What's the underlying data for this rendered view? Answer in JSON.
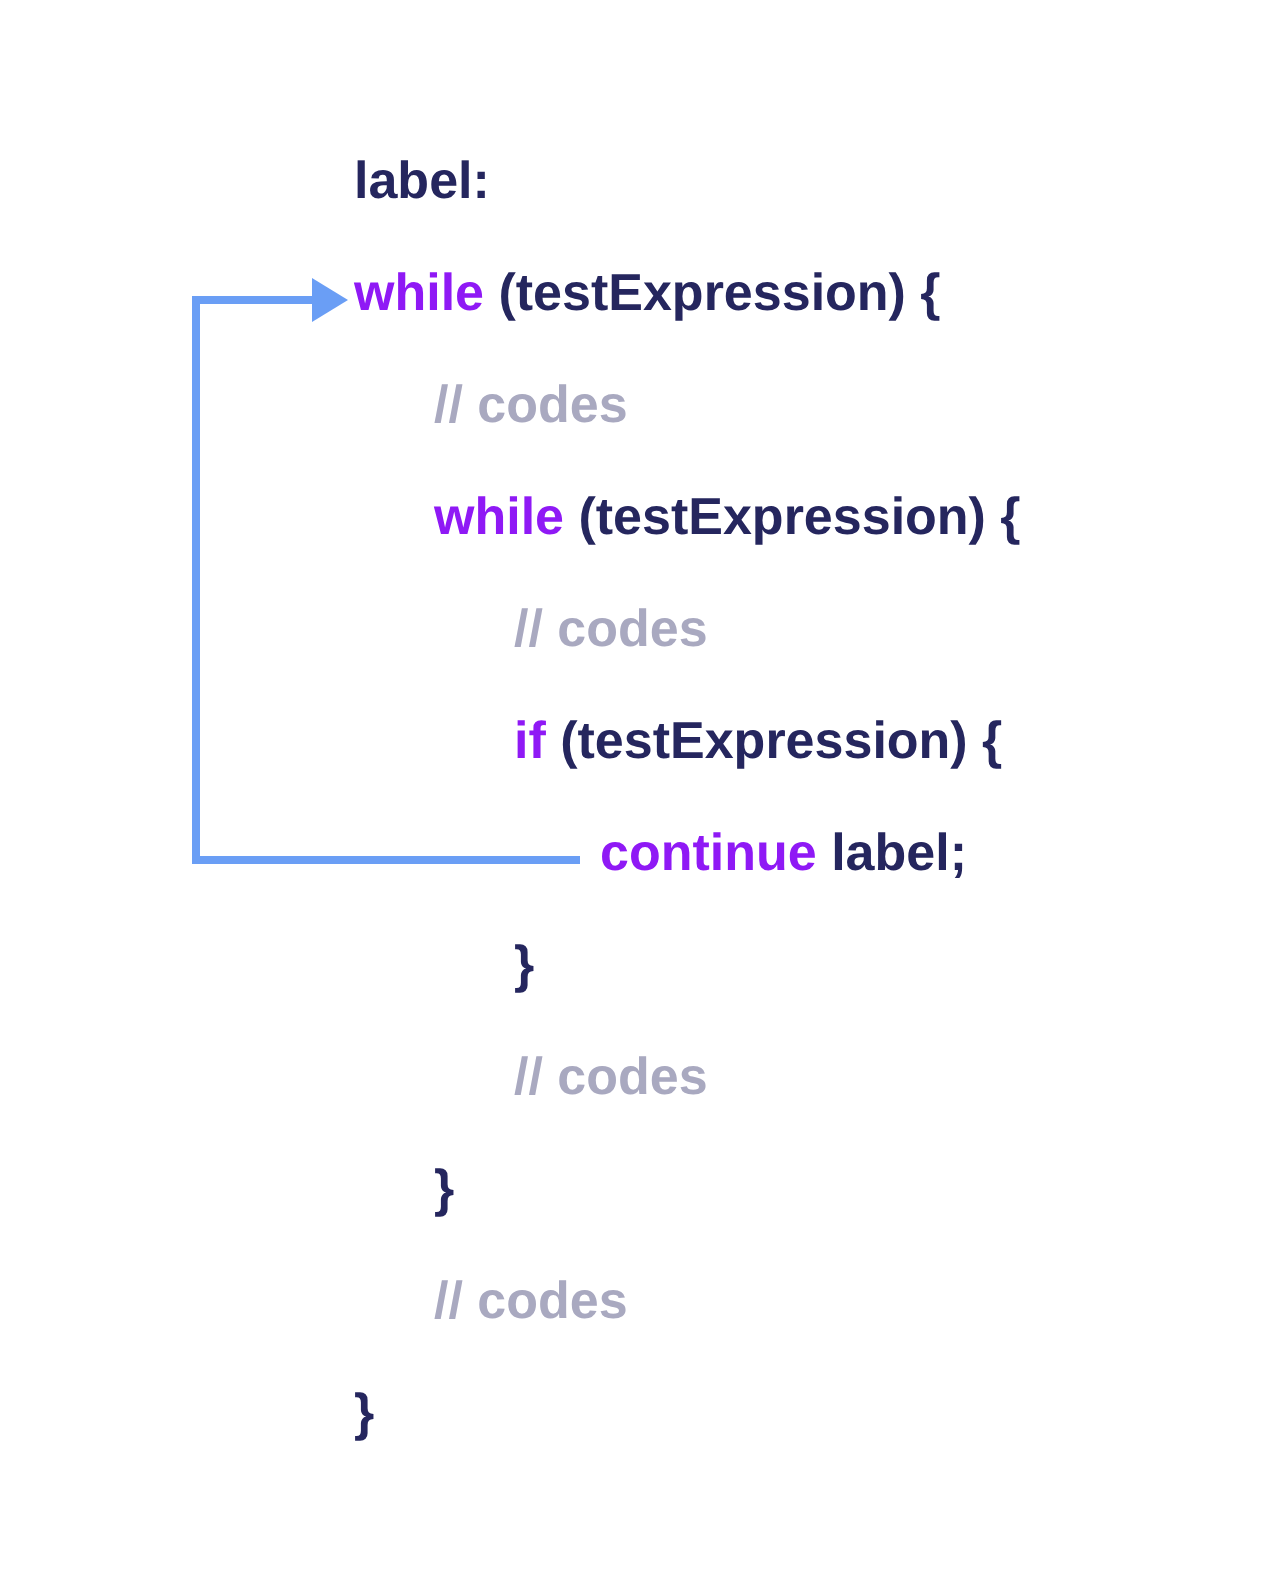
{
  "code": [
    {
      "segments": [
        {
          "kind": "plain",
          "text": "label:"
        }
      ]
    },
    {
      "segments": [
        {
          "kind": "keyword",
          "text": "while"
        },
        {
          "kind": "plain",
          "text": " (testExpression) {"
        }
      ],
      "children": [
        {
          "segments": [
            {
              "kind": "comment",
              "text": "// codes"
            }
          ]
        },
        {
          "segments": [
            {
              "kind": "keyword",
              "text": "while"
            },
            {
              "kind": "plain",
              "text": " (testExpression) {"
            }
          ],
          "children": [
            {
              "segments": [
                {
                  "kind": "comment",
                  "text": "// codes"
                }
              ]
            },
            {
              "segments": [
                {
                  "kind": "keyword",
                  "text": "if"
                },
                {
                  "kind": "plain",
                  "text": " (testExpression) {"
                }
              ],
              "children": [
                {
                  "segments": [
                    {
                      "kind": "keyword",
                      "text": "continue"
                    },
                    {
                      "kind": "plain",
                      "text": " label;"
                    }
                  ]
                }
              ]
            },
            {
              "segments": [
                {
                  "kind": "plain",
                  "text": "}"
                }
              ]
            },
            {
              "segments": [
                {
                  "kind": "comment",
                  "text": "// codes"
                }
              ]
            }
          ]
        },
        {
          "segments": [
            {
              "kind": "plain",
              "text": "}"
            }
          ]
        },
        {
          "segments": [
            {
              "kind": "comment",
              "text": "// codes"
            }
          ]
        }
      ]
    },
    {
      "segments": [
        {
          "kind": "plain",
          "text": "}"
        }
      ]
    }
  ]
}
